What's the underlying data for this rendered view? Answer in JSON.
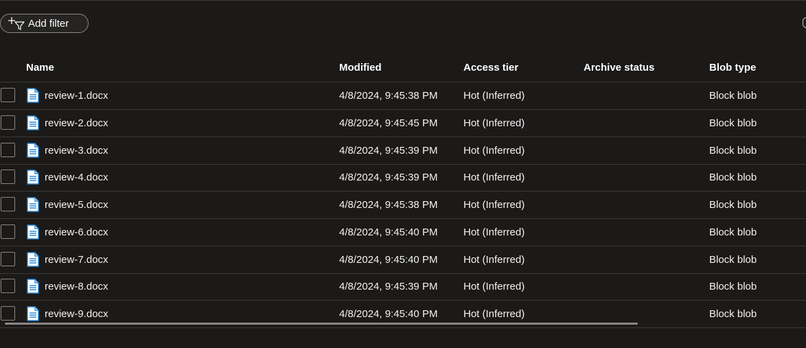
{
  "toolbar": {
    "add_filter_label": "Add filter"
  },
  "table": {
    "columns": {
      "name": "Name",
      "modified": "Modified",
      "access_tier": "Access tier",
      "archive_status": "Archive status",
      "blob_type": "Blob type"
    },
    "rows": [
      {
        "name": "review-1.docx",
        "modified": "4/8/2024, 9:45:38 PM",
        "access_tier": "Hot (Inferred)",
        "archive_status": "",
        "blob_type": "Block blob"
      },
      {
        "name": "review-2.docx",
        "modified": "4/8/2024, 9:45:45 PM",
        "access_tier": "Hot (Inferred)",
        "archive_status": "",
        "blob_type": "Block blob"
      },
      {
        "name": "review-3.docx",
        "modified": "4/8/2024, 9:45:39 PM",
        "access_tier": "Hot (Inferred)",
        "archive_status": "",
        "blob_type": "Block blob"
      },
      {
        "name": "review-4.docx",
        "modified": "4/8/2024, 9:45:39 PM",
        "access_tier": "Hot (Inferred)",
        "archive_status": "",
        "blob_type": "Block blob"
      },
      {
        "name": "review-5.docx",
        "modified": "4/8/2024, 9:45:38 PM",
        "access_tier": "Hot (Inferred)",
        "archive_status": "",
        "blob_type": "Block blob"
      },
      {
        "name": "review-6.docx",
        "modified": "4/8/2024, 9:45:40 PM",
        "access_tier": "Hot (Inferred)",
        "archive_status": "",
        "blob_type": "Block blob"
      },
      {
        "name": "review-7.docx",
        "modified": "4/8/2024, 9:45:40 PM",
        "access_tier": "Hot (Inferred)",
        "archive_status": "",
        "blob_type": "Block blob"
      },
      {
        "name": "review-8.docx",
        "modified": "4/8/2024, 9:45:39 PM",
        "access_tier": "Hot (Inferred)",
        "archive_status": "",
        "blob_type": "Block blob"
      },
      {
        "name": "review-9.docx",
        "modified": "4/8/2024, 9:45:40 PM",
        "access_tier": "Hot (Inferred)",
        "archive_status": "",
        "blob_type": "Block blob"
      }
    ]
  },
  "icons": {
    "filter": "add-filter-icon",
    "file": "word-document-icon"
  },
  "colors": {
    "background": "#1b1a19",
    "divider": "#3b3a39",
    "icon_blue": "#2b88d8"
  }
}
